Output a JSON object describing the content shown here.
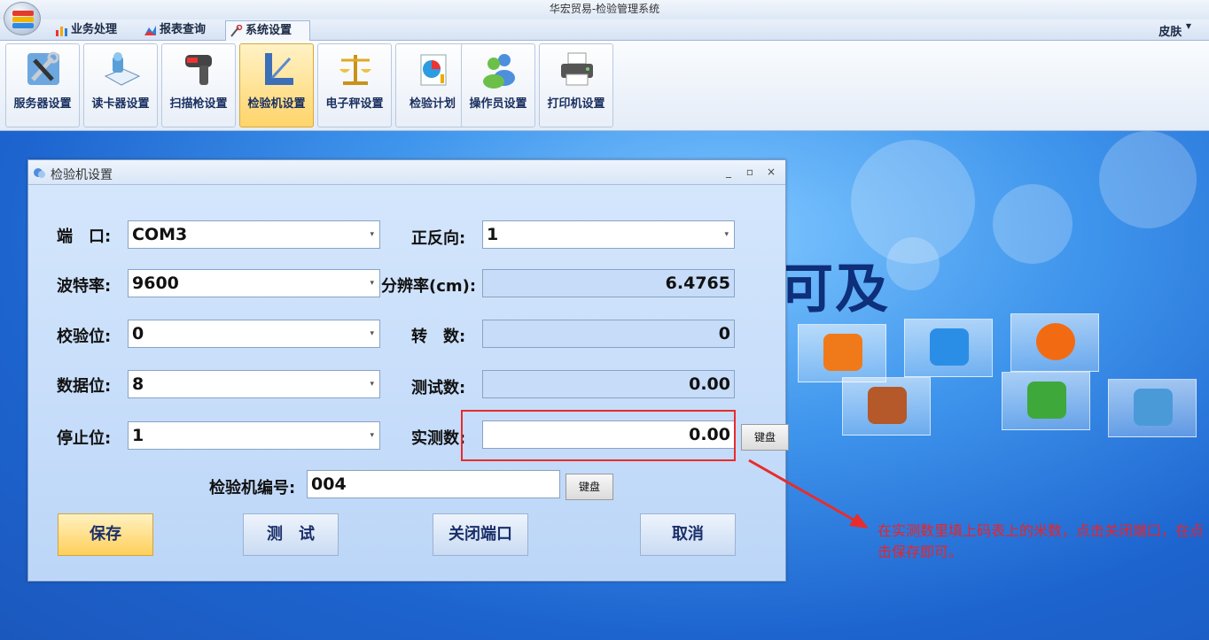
{
  "window": {
    "title": "华宏贸易-检验管理系统"
  },
  "tabs": [
    {
      "label": "业务处理",
      "active": false
    },
    {
      "label": "报表查询",
      "active": false
    },
    {
      "label": "系统设置",
      "active": true
    }
  ],
  "skin_menu": {
    "label": "皮肤"
  },
  "ribbon": {
    "buttons": [
      {
        "label": "服务器设置",
        "icon": "tools-icon",
        "active": false
      },
      {
        "label": "读卡器设置",
        "icon": "card-reader-icon",
        "active": false
      },
      {
        "label": "扫描枪设置",
        "icon": "barcode-scanner-icon",
        "active": false
      },
      {
        "label": "检验机设置",
        "icon": "ruler-icon",
        "active": true
      },
      {
        "label": "电子秤设置",
        "icon": "scale-icon",
        "active": false
      },
      {
        "label": "检验计划",
        "icon": "chart-icon",
        "active": false
      },
      {
        "label": "操作员设置",
        "icon": "users-icon",
        "active": false
      },
      {
        "label": "打印机设置",
        "icon": "printer-icon",
        "active": false
      }
    ]
  },
  "desktop": {
    "banner_text": "可及"
  },
  "dialog": {
    "title": "检验机设置",
    "fields": {
      "port": {
        "label": "端　口:",
        "value": "COM3"
      },
      "baud": {
        "label": "波特率:",
        "value": "9600"
      },
      "parity": {
        "label": "校验位:",
        "value": "0"
      },
      "databits": {
        "label": "数据位:",
        "value": "8"
      },
      "stopbits": {
        "label": "停止位:",
        "value": "1"
      },
      "direction": {
        "label": "正反向:",
        "value": "1"
      },
      "resolution": {
        "label": "分辨率(cm):",
        "value": "6.4765"
      },
      "revolutions": {
        "label": "转　数:",
        "value": "0"
      },
      "test_count": {
        "label": "测试数:",
        "value": "0.00"
      },
      "measured": {
        "label": "实测数:",
        "value": "0.00"
      },
      "machine_no": {
        "label": "检验机编号:",
        "value": "004"
      }
    },
    "keyboard_label": "键盘",
    "buttons": {
      "save": "保存",
      "test": "测　试",
      "close_port": "关闭端口",
      "cancel": "取消"
    }
  },
  "annotation": {
    "note": "在实测数里填上码表上的米数，点击关闭端口，在点击保存即可。",
    "color": "#e82c2c"
  }
}
